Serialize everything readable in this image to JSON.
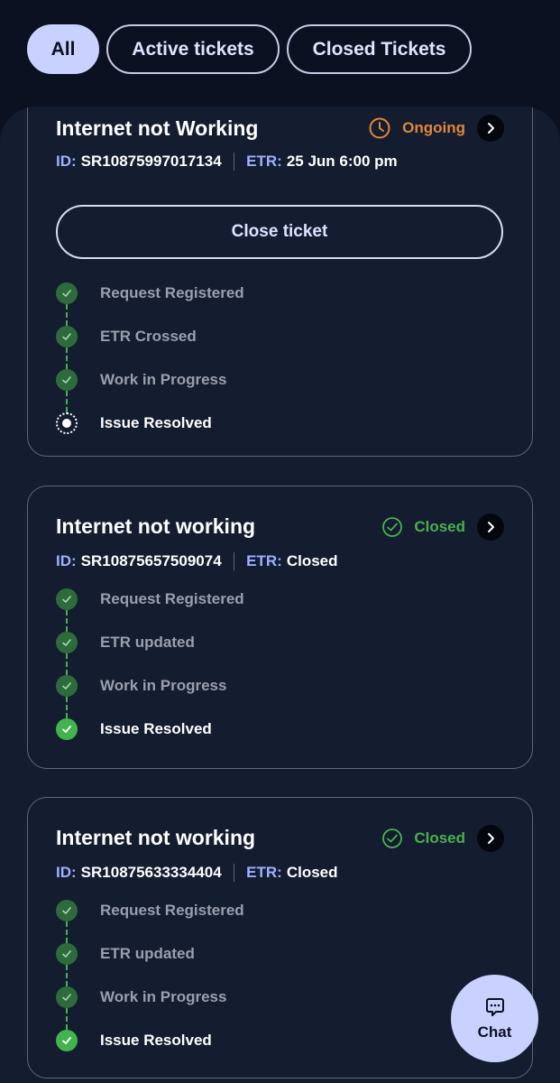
{
  "filters": [
    {
      "label": "All",
      "active": true
    },
    {
      "label": "Active tickets",
      "active": false
    },
    {
      "label": "Closed Tickets",
      "active": false
    }
  ],
  "tickets": [
    {
      "title": "Internet not Working",
      "status": "Ongoing",
      "status_color": "#e0873a",
      "id_label": "ID:",
      "id": "SR10875997017134",
      "etr_label": "ETR:",
      "etr": "25 Jun 6:00 pm",
      "close_button": "Close ticket",
      "steps": [
        "Request Registered",
        "ETR Crossed",
        "Work in Progress",
        "Issue Resolved"
      ]
    },
    {
      "title": "Internet not working",
      "status": "Closed",
      "status_color": "#4caf50",
      "id_label": "ID:",
      "id": "SR10875657509074",
      "etr_label": "ETR:",
      "etr": "Closed",
      "steps": [
        "Request Registered",
        "ETR updated",
        "Work in Progress",
        "Issue Resolved"
      ]
    },
    {
      "title": "Internet not working",
      "status": "Closed",
      "status_color": "#4caf50",
      "id_label": "ID:",
      "id": "SR10875633334404",
      "etr_label": "ETR:",
      "etr": "Closed",
      "steps": [
        "Request Registered",
        "ETR updated",
        "Work in Progress",
        "Issue Resolved"
      ]
    }
  ],
  "chat": {
    "label": "Chat",
    "icon": "chat-bubble-icon"
  },
  "colors": {
    "accent": "#c9d1ff",
    "background": "#0b1120",
    "panel": "#141c2f",
    "ongoing": "#e0873a",
    "closed": "#4caf50"
  }
}
